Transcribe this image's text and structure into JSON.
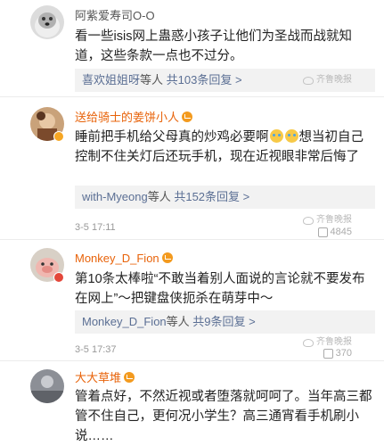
{
  "comments": [
    {
      "username": "阿紫爱寿司O-O",
      "username_style": "grey",
      "crown": false,
      "badge": "none",
      "text": "看一些isis网上蛊惑小孩子让他们为圣战而战就知道，这些条款一点也不过分。",
      "reply_names": "喜欢姐姐呀",
      "reply_suffix": "等人",
      "reply_count": "共103条回复",
      "reply_arrow": ">",
      "watermark": "齐鲁晚报",
      "timestamp": "",
      "likes": ""
    },
    {
      "username": "送给骑士的姜饼小人",
      "username_style": "orange",
      "crown": true,
      "badge": "vip",
      "text_part1": "睡前把手机给父母真的炒鸡必要啊",
      "text_part2": "想当初自己控制不住关灯后还玩手机，现在近视眼非常后悔了",
      "emoji_icons": [
        "crying-emoji",
        "crying-emoji"
      ],
      "reply_names": "with-Myeong",
      "reply_suffix": "等人",
      "reply_count": "共152条回复",
      "reply_arrow": ">",
      "timestamp": "3-5 17:11",
      "likes": "4845",
      "watermark": "齐鲁晚报"
    },
    {
      "username": "Monkey_D_Fion",
      "username_style": "orange",
      "crown": true,
      "badge": "red",
      "text": "第10条太棒啦“不敢当着别人面说的言论就不要发布在网上”～把键盘侠扼杀在萌芽中～",
      "reply_names": "Monkey_D_Fion",
      "reply_suffix": "等人",
      "reply_count": "共9条回复",
      "reply_arrow": ">",
      "timestamp": "3-5 17:37",
      "likes": "370",
      "watermark": "齐鲁晚报"
    },
    {
      "username": "大大草堆",
      "username_style": "orange",
      "crown": true,
      "badge": "none",
      "text": "管着点好，不然近视或者堕落就呵呵了。当年高三都管不住自己，更何况小学生？高三通宵看手机刷小说……",
      "timestamp": "",
      "likes": ""
    }
  ],
  "icons": {
    "like": "thumbs-up-icon",
    "watermark": "watermark-logo-icon",
    "crown": "crown-badge-icon"
  },
  "colors": {
    "username_orange": "#e8630a",
    "link_blue": "#5b6f94",
    "reply_bg": "#f2f2f2",
    "text": "#222222",
    "meta": "#999999"
  }
}
